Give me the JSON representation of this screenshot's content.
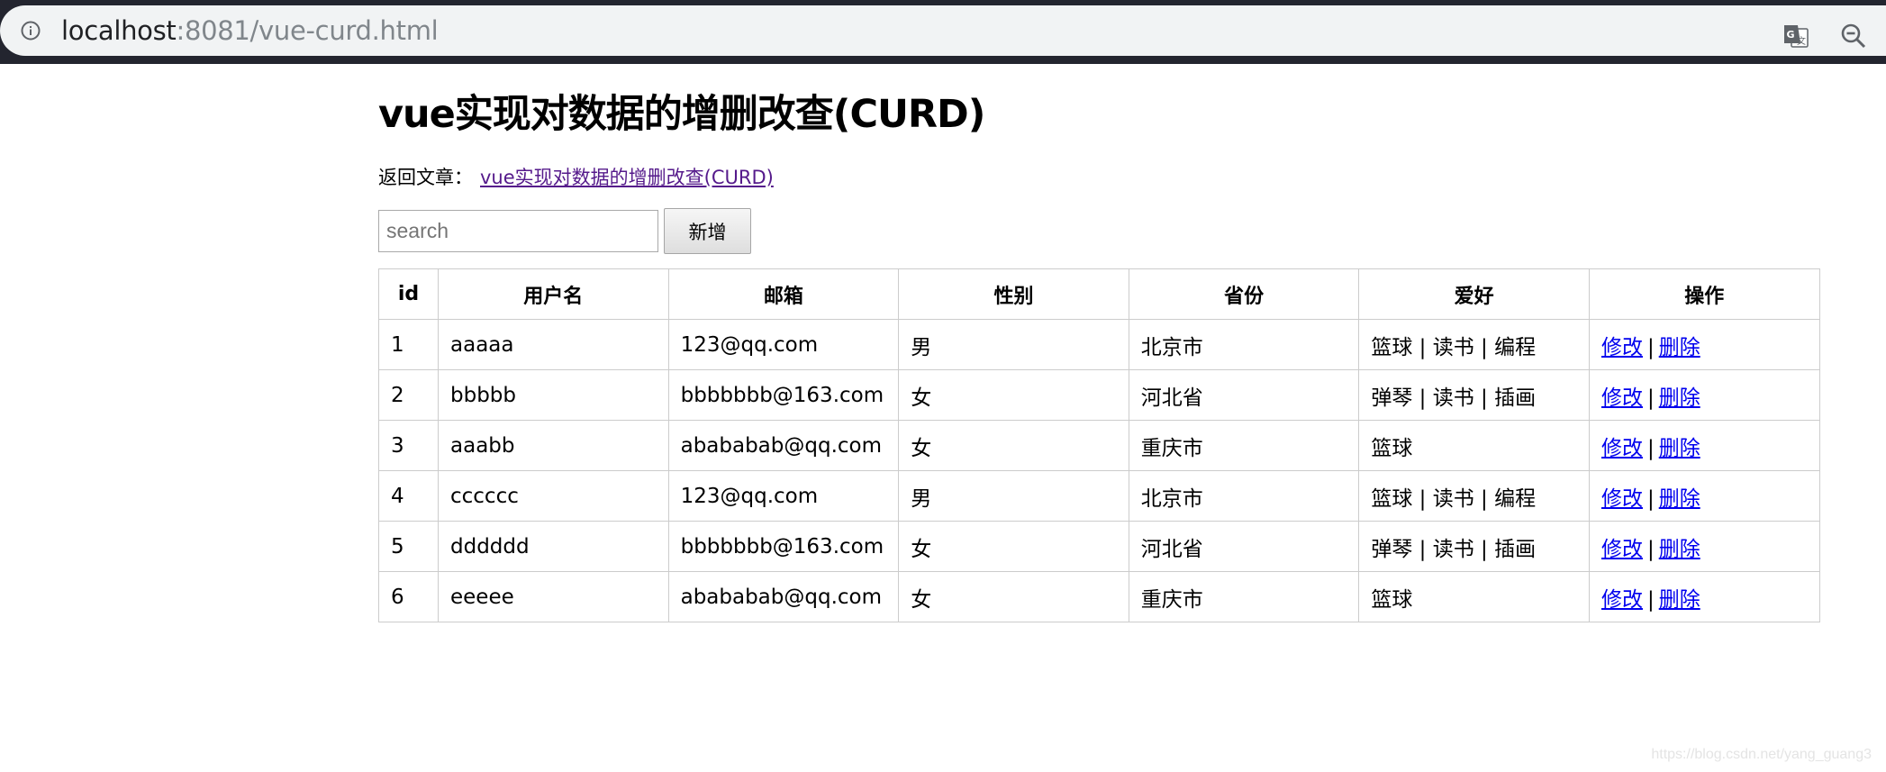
{
  "browser": {
    "url_host": "localhost",
    "url_rest": ":8081/vue-curd.html",
    "icons": [
      "info-icon",
      "translate-icon",
      "zoom-out-icon"
    ]
  },
  "page": {
    "title": "vue实现对数据的增删改查(CURD)",
    "back_label": "返回文章：",
    "back_link_text": "vue实现对数据的增删改查(CURD)"
  },
  "toolbar": {
    "search_value": "",
    "search_placeholder": "search",
    "add_label": "新增"
  },
  "table": {
    "headers": [
      "id",
      "用户名",
      "邮箱",
      "性别",
      "省份",
      "爱好",
      "操作"
    ],
    "rows": [
      {
        "id": "1",
        "username": "aaaaa",
        "email": "123@qq.com",
        "gender": "男",
        "province": "北京市",
        "hobbies": "篮球 | 读书 | 编程"
      },
      {
        "id": "2",
        "username": "bbbbb",
        "email": "bbbbbbb@163.com",
        "gender": "女",
        "province": "河北省",
        "hobbies": "弹琴 | 读书 | 插画"
      },
      {
        "id": "3",
        "username": "aaabb",
        "email": "abababab@qq.com",
        "gender": "女",
        "province": "重庆市",
        "hobbies": "篮球"
      },
      {
        "id": "4",
        "username": "cccccc",
        "email": "123@qq.com",
        "gender": "男",
        "province": "北京市",
        "hobbies": "篮球 | 读书 | 编程"
      },
      {
        "id": "5",
        "username": "dddddd",
        "email": "bbbbbbb@163.com",
        "gender": "女",
        "province": "河北省",
        "hobbies": "弹琴 | 读书 | 插画"
      },
      {
        "id": "6",
        "username": "eeeee",
        "email": "abababab@qq.com",
        "gender": "女",
        "province": "重庆市",
        "hobbies": "篮球"
      }
    ],
    "actions": {
      "edit": "修改",
      "separator": "|",
      "delete": "删除"
    }
  },
  "colors": {
    "link_visited": "#551a8b",
    "link": "#0000ee",
    "border": "#cccccc",
    "chrome_dark": "#23252f",
    "omnibox": "#f1f3f4"
  },
  "watermark": "https://blog.csdn.net/yang_guang3"
}
